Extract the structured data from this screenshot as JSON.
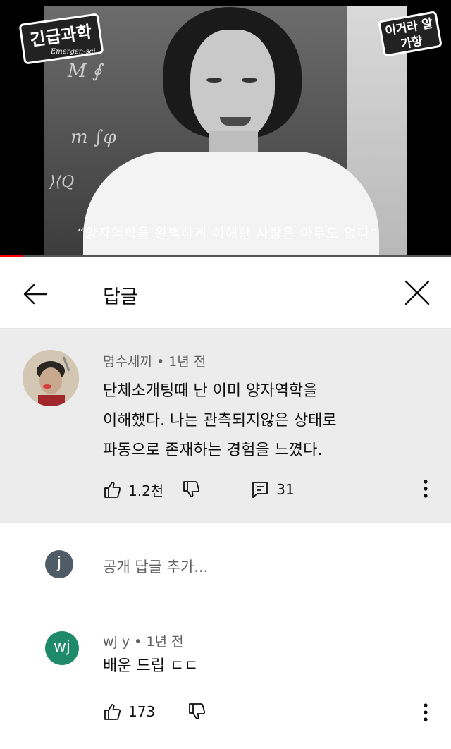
{
  "video": {
    "logo_left": "긴급과학",
    "logo_left_sub": "Emergen-sci.",
    "logo_right": "이거라 알가향",
    "subtitle": "“양자역학을 완벽하게 이해한 사람은 아무도 없다”",
    "progress_fraction": 0.05
  },
  "header": {
    "title": "답글"
  },
  "pinned_comment": {
    "author": "명수세끼",
    "time": "1년 전",
    "lines": [
      "단체소개팅때 난 이미 양자역학을",
      "이해했다. 나는 관측되지않은 상태로",
      "파동으로 존재하는 경험을 느꼈다."
    ],
    "likes": "1.2천",
    "replies": "31"
  },
  "reply_input": {
    "avatar_letter": "j",
    "placeholder": "공개 답글 추가..."
  },
  "reply": {
    "avatar_letters": "wj",
    "author": "wj y",
    "time": "1년 전",
    "text": "배운 드립 ㄷㄷ",
    "likes": "173"
  },
  "colors": {
    "progress": "#ff0000",
    "pinned_bg": "#ececec",
    "wj_avatar": "#1f8a6a",
    "j_avatar": "#4f5b66"
  }
}
